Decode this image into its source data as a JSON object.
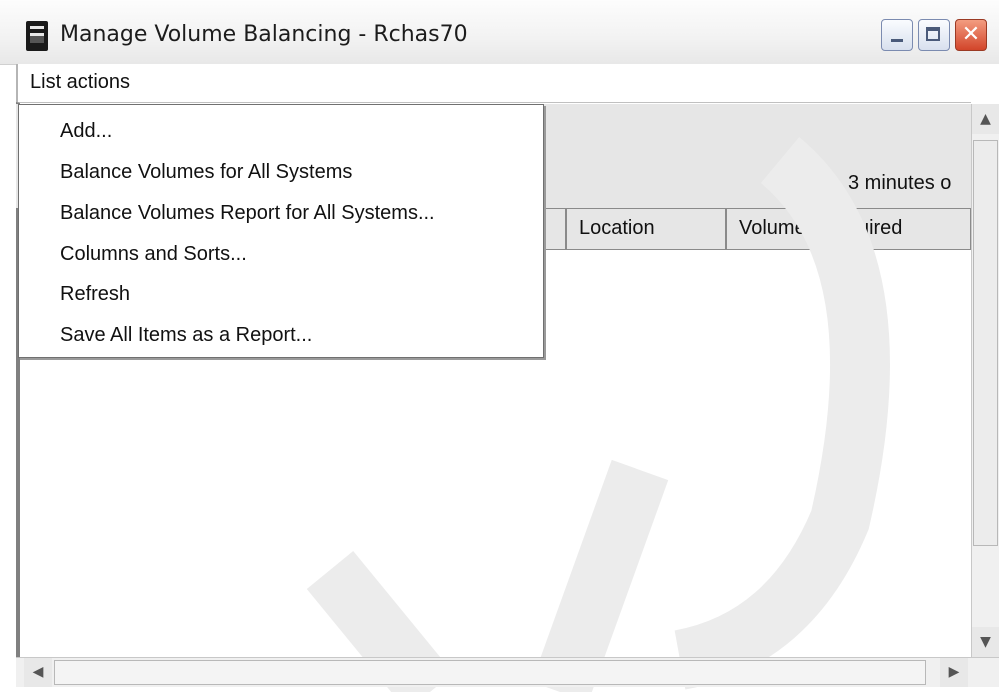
{
  "window": {
    "title": "Manage Volume Balancing - Rchas70",
    "close_glyph": "✕"
  },
  "menubar": {
    "menu_label": "List actions"
  },
  "dropdown": {
    "items": [
      "Add...",
      "Balance Volumes for All Systems",
      "Balance Volumes Report for All Systems...",
      "Columns and Sorts...",
      "Refresh",
      "Save All Items as a Report..."
    ]
  },
  "list": {
    "status": "3 minutes o",
    "columns": [
      "Location",
      "Volumes Required"
    ]
  },
  "icons": {
    "app": "server-icon",
    "minimize": "minimize-icon",
    "maximize": "maximize-icon",
    "close": "close-icon",
    "scroll_up": "arrow-up-icon",
    "scroll_down": "arrow-down-icon",
    "scroll_left": "arrow-left-icon",
    "scroll_right": "arrow-right-icon"
  },
  "colors": {
    "close_button": "#d2452a",
    "header_strip": "#e6e6e6",
    "watermark": "#e9e9e9"
  }
}
